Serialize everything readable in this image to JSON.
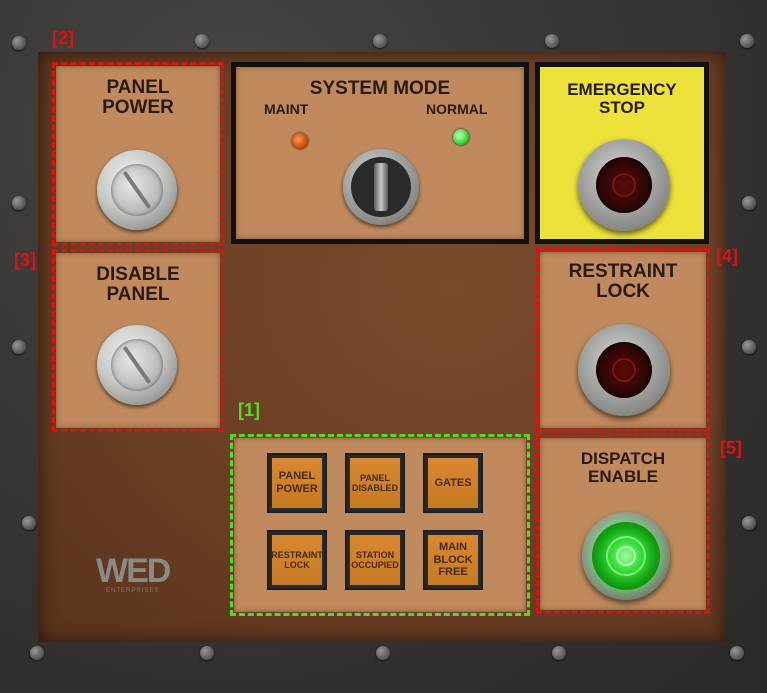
{
  "panels": {
    "panel_power": {
      "label": "PANEL\nPOWER"
    },
    "disable_panel": {
      "label": "DISABLE\nPANEL"
    },
    "system_mode": {
      "title": "SYSTEM MODE",
      "left_label": "MAINT",
      "right_label": "NORMAL",
      "left_led_color": "#e05a10",
      "right_led_color": "#39e039"
    },
    "emergency_stop": {
      "label": "EMERGENCY\nSTOP",
      "bg_color": "#ece23a"
    },
    "restraint_lock": {
      "label": "RESTRAINT\nLOCK"
    },
    "dispatch_enable": {
      "label": "DISPATCH\nENABLE"
    }
  },
  "indicators": [
    {
      "text": "PANEL\nPOWER",
      "size": "big"
    },
    {
      "text": "PANEL\nDISABLED",
      "size": "small"
    },
    {
      "text": "GATES",
      "size": "big"
    },
    {
      "text": "RESTRAINT\nLOCK",
      "size": "small"
    },
    {
      "text": "STATION\nOCCUPIED",
      "size": "small"
    },
    {
      "text": "MAIN\nBLOCK\nFREE",
      "size": "big"
    }
  ],
  "logo": {
    "text": "WED",
    "sub": "ENTERPRISES"
  },
  "annotations": [
    {
      "tag": "[1]",
      "color": "green"
    },
    {
      "tag": "[2]",
      "color": "red"
    },
    {
      "tag": "[3]",
      "color": "red"
    },
    {
      "tag": "[4]",
      "color": "red"
    },
    {
      "tag": "[5]",
      "color": "red"
    }
  ],
  "colors": {
    "accent_red": "#e01010",
    "accent_green": "#4ce01c",
    "panel_tan": "#c08a5e"
  }
}
